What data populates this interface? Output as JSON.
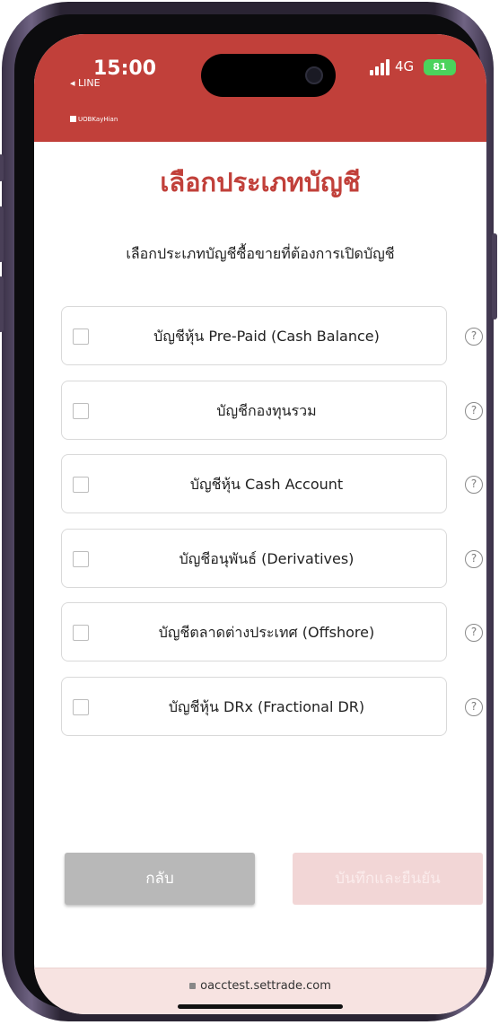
{
  "status_bar": {
    "time": "15:00",
    "back_app": "◂ LINE",
    "network": "4G",
    "battery": "81"
  },
  "brand": {
    "name": "UOBKayHian"
  },
  "page": {
    "title": "เลือกประเภทบัญชี",
    "subtitle": "เลือกประเภทบัญชีซื้อขายที่ต้องการเปิดบัญชี"
  },
  "options": [
    {
      "label": "บัญชีหุ้น Pre-Paid (Cash Balance)",
      "checked": false
    },
    {
      "label": "บัญชีกองทุนรวม",
      "checked": false
    },
    {
      "label": "บัญชีหุ้น Cash Account",
      "checked": false
    },
    {
      "label": "บัญชีอนุพันธ์ (Derivatives)",
      "checked": false
    },
    {
      "label": "บัญชีตลาดต่างประเทศ (Offshore)",
      "checked": false
    },
    {
      "label": "บัญชีหุ้น DRx (Fractional DR)",
      "checked": false
    }
  ],
  "help_symbol": "?",
  "buttons": {
    "back": "กลับ",
    "next": "บันทึกและยืนยัน"
  },
  "browser": {
    "url": "oacctest.settrade.com"
  },
  "colors": {
    "brand_red": "#c1403a",
    "disabled_button": "#f2d6d6",
    "back_button": "#b8b8b8",
    "footer_bg": "#f7e3e1"
  },
  "icons": [
    "signal-icon",
    "battery-icon",
    "help-icon",
    "lock-icon",
    "checkbox-icon"
  ]
}
